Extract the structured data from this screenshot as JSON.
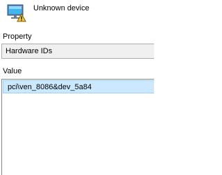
{
  "device": {
    "name": "Unknown device",
    "icon": "unknown-device-icon"
  },
  "property": {
    "label": "Property",
    "selected": "Hardware IDs"
  },
  "value": {
    "label": "Value",
    "items": [
      "pci\\ven_8086&dev_5a84"
    ],
    "selected_index": 0
  },
  "colors": {
    "selection_background": "#cce8ff",
    "selection_border": "#99d1ff",
    "select_background": "#f0f0f0"
  }
}
